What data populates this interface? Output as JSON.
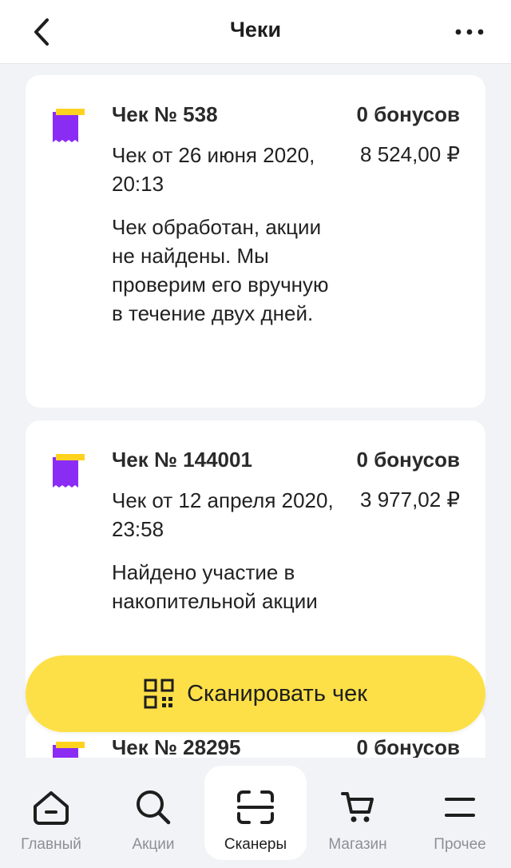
{
  "header": {
    "title": "Чеки"
  },
  "receipts": [
    {
      "number": "Чек № 538",
      "bonus": "0 бонусов",
      "date": "Чек от 26 июня 2020, 20:13",
      "amount": "8 524,00 ₽",
      "status": "Чек обработан, акции не найдены. Мы проверим его вручную в течение двух дней."
    },
    {
      "number": "Чек № 144001",
      "bonus": "0 бонусов",
      "date": "Чек от 12 апреля 2020, 23:58",
      "amount": "3 977,02 ₽",
      "status": "Найдено участие в накопительной акции"
    },
    {
      "number": "Чек № 28295",
      "bonus": "0 бонусов"
    }
  ],
  "scan_button": {
    "label": "Сканировать чек"
  },
  "tabs": [
    {
      "label": "Главный",
      "icon": "home-icon"
    },
    {
      "label": "Акции",
      "icon": "search-icon"
    },
    {
      "label": "Сканеры",
      "icon": "scan-icon",
      "active": true
    },
    {
      "label": "Магазин",
      "icon": "cart-icon"
    },
    {
      "label": "Прочее",
      "icon": "menu-icon"
    }
  ],
  "colors": {
    "accent_yellow": "#fde047",
    "receipt_purple": "#8b2cf5",
    "receipt_yellow": "#ffd21f",
    "background": "#f2f3f7"
  }
}
